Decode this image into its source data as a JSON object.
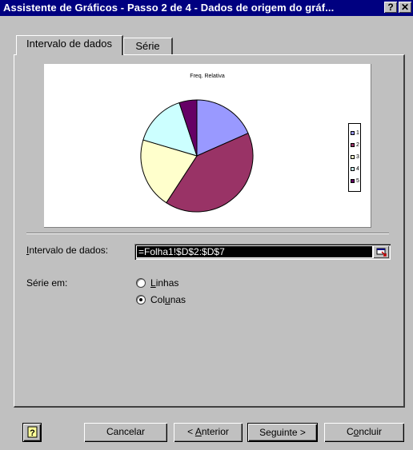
{
  "window": {
    "title": "Assistente de Gráficos - Passo 2 de 4 - Dados de origem do gráf...",
    "help_glyph": "?",
    "close_glyph": "✕"
  },
  "tabs": [
    {
      "label": "Intervalo de dados",
      "active": true
    },
    {
      "label": "Série",
      "active": false
    }
  ],
  "chart_data": {
    "type": "pie",
    "title": "Freq. Relativa",
    "categories": [
      "1",
      "2",
      "3",
      "4",
      "5"
    ],
    "values": [
      18,
      40,
      20,
      15,
      5
    ],
    "colors": [
      "#9999ff",
      "#993366",
      "#ffffcc",
      "#ccffff",
      "#660066"
    ],
    "legend_position": "right"
  },
  "form": {
    "range_label_prefix": "",
    "range_label_underlined": "I",
    "range_label_rest": "ntervalo de dados:",
    "range_value": "=Folha1!$D$2:$D$7",
    "series_in_label": "Série em:",
    "option_rows_u": "L",
    "option_rows_rest": "inhas",
    "option_cols_pre": "Col",
    "option_cols_u": "u",
    "option_cols_rest": "nas",
    "selected": "columns"
  },
  "buttons": {
    "help_icon": "?",
    "cancel": "Cancelar",
    "back_pre": "< ",
    "back_u": "A",
    "back_rest": "nterior",
    "next": "Seguinte >",
    "finish_pre": "C",
    "finish_u": "o",
    "finish_rest": "ncluir"
  }
}
